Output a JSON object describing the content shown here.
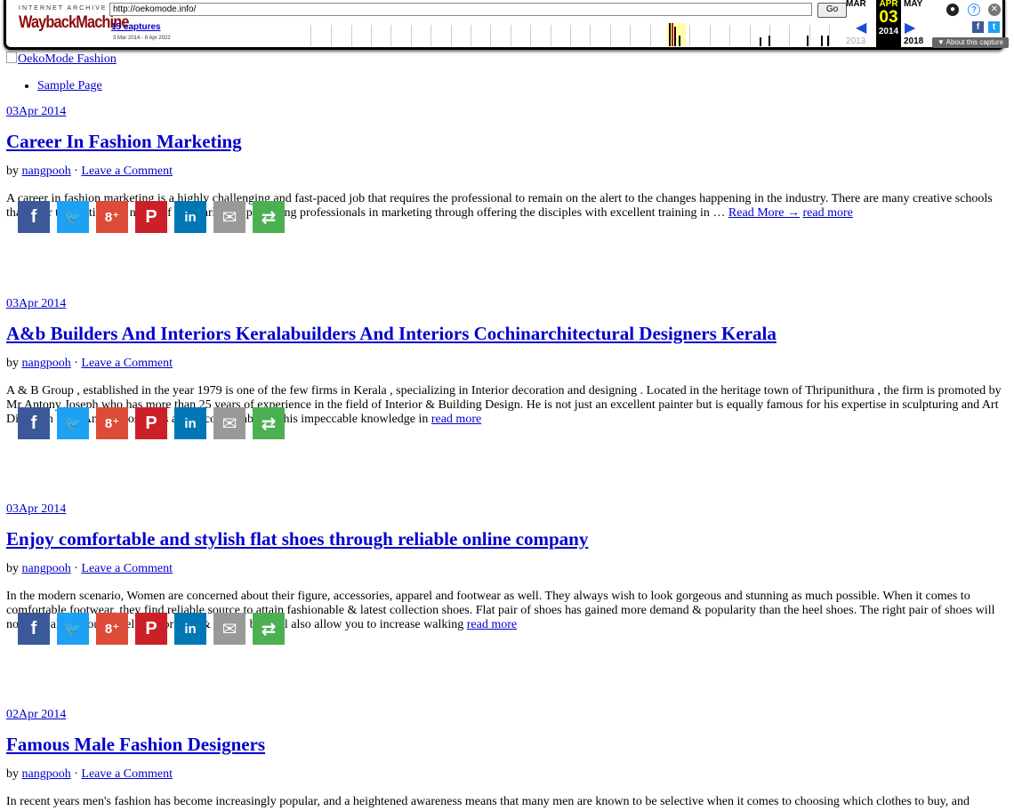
{
  "wayback": {
    "brand_top": "INTERNET ARCHIVE",
    "brand_main": "WaybackMachine",
    "url": "http://oekomode.info/",
    "go_label": "Go",
    "captures_link": "15 captures",
    "date_range": "3 Mar 2014 - 8 Apr 2022",
    "month_prev": "MAR",
    "month_cur": "APR",
    "month_next": "MAY",
    "day_cur": "03",
    "year_prev": "2013",
    "year_cur": "2014",
    "year_next": "2018",
    "about_label": "▼ About this capture",
    "colors": {
      "frame": "#000000",
      "brand": "#8c0a0a",
      "current_bg": "#000000",
      "current_text": "#ffff00",
      "arrow": "#1a4ed8"
    }
  },
  "site": {
    "logo_alt": "OekoMode Fashion",
    "menu": [
      "Sample Page"
    ]
  },
  "share_icons": [
    {
      "name": "facebook-icon",
      "glyph": "f",
      "color": "#3b5998"
    },
    {
      "name": "twitter-icon",
      "glyph": "🐦",
      "color": "#1da1f2"
    },
    {
      "name": "google-plus-icon",
      "glyph": "8⁺",
      "color": "#dd4b39"
    },
    {
      "name": "pinterest-icon",
      "glyph": "P",
      "color": "#cb2027"
    },
    {
      "name": "linkedin-icon",
      "glyph": "in",
      "color": "#0077b5"
    },
    {
      "name": "email-icon",
      "glyph": "✉",
      "color": "#999999"
    },
    {
      "name": "more-share-icon",
      "glyph": "⇄",
      "color": "#4caf50"
    }
  ],
  "posts": [
    {
      "date": "03Apr 2014",
      "title": "Career In Fashion Marketing",
      "by": "by",
      "author": "nangpooh",
      "sep": "·",
      "comment": "Leave a Comment",
      "excerpt": "A career in fashion marketing is a highly challenging and fast-paced job that requires the professional to remain on the alert to the changes happening in the industry. There are many creative schools that cater to meeting the needs of the market by producing professionals in marketing through offering the disciples with excellent training in … ",
      "read_more_arrow": "Read More →",
      "read_more": "read more"
    },
    {
      "date": "03Apr 2014",
      "title": "A&b Builders And Interiors Keralabuilders And Interiors Cochinarchitectural Designers Kerala",
      "by": "by",
      "author": "nangpooh",
      "sep": "·",
      "comment": "Leave a Comment",
      "excerpt": "A & B Group , established in the year 1979 is one of the few firms in Kerala , specializing in Interior decoration and designing . Located in the heritage town of Thripunithura , the firm is promoted by Mr Antony Joseph who has more than 25 years of experience in the field of Interior & Building Design. He is not just an excellent painter but is equally famous for his expertise in sculpturing and Art Direction . Mr. Antony Joseph is also incomparable for his impeccable knowledge in ",
      "read_more": "read more"
    },
    {
      "date": "03Apr 2014",
      "title": "Enjoy comfortable and stylish flat shoes through reliable online company",
      "by": "by",
      "author": "nangpooh",
      "sep": "·",
      "comment": "Leave a Comment",
      "excerpt": "In the modern scenario, Women are concerned about their figure, accessories, apparel and footwear as well. They always wish to look gorgeous and stunning as much possible. When it comes to comfortable footwear, they find reliable source to attain fashionable & latest collection shoes. Flat pair of shoes has gained more demand & popularity than the heel shoes. The right pair of shoes will not only allow you to feel comfortable & happy, but will also allow you to increase walking ",
      "read_more": "read more"
    },
    {
      "date": "02Apr 2014",
      "title": "Famous Male Fashion Designers",
      "by": "by",
      "author": "nangpooh",
      "sep": "·",
      "comment": "Leave a Comment",
      "excerpt": "In recent years men's fashion has become increasingly popular, and a heightened awareness means that many men are known to be selective when it comes to choosing which clothes to buy, and"
    }
  ]
}
